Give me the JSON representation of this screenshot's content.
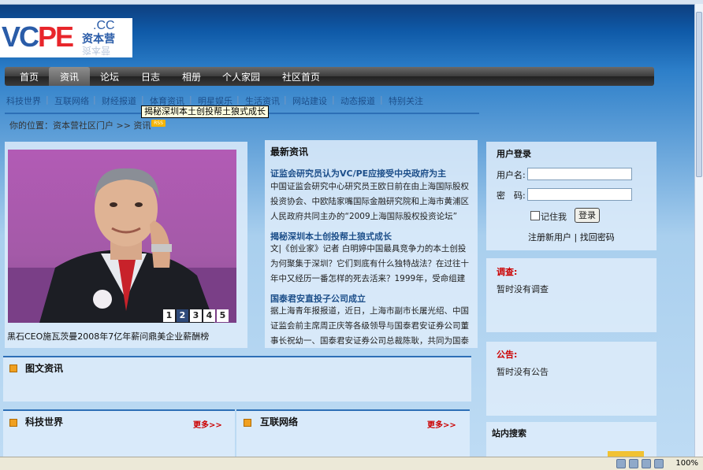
{
  "logo": {
    "text_main": "VC",
    "text_pe": "PE",
    "domain": ".CC",
    "cn": "资本营",
    "reflection": "资本营"
  },
  "nav": [
    "首页",
    "资讯",
    "论坛",
    "日志",
    "相册",
    "个人家园",
    "社区首页"
  ],
  "nav_active": 1,
  "subnav": [
    "科技世界",
    "互联网络",
    "财经报道",
    "体育资讯",
    "明星娱乐",
    "生活资讯",
    "网站建设",
    "动态报道",
    "特别关注"
  ],
  "tooltip": "揭秘深圳本土创投帮土狼式成长",
  "breadcrumb": {
    "prefix": "你的位置：资本营社区门户  >> 资讯",
    "rss": "RSS"
  },
  "photo": {
    "caption": "黑石CEO施瓦茨曼2008年7亿年薪问鼎美企业薪酬榜",
    "pages": [
      "1",
      "2",
      "3",
      "4",
      "5"
    ],
    "active_page": 1
  },
  "latest": {
    "title": "最新资讯",
    "items": [
      {
        "title": "证监会研究员认为VC/PE应接受中央政府为主",
        "body": "中国证监会研究中心研究员王欧日前在由上海国际股权投资协会、中欧陆家嘴国际金融研究院和上海市黄浦区人民政府共同主办的“2009上海国际股权投资论坛”"
      },
      {
        "title": "揭秘深圳本土创投帮土狼式成长",
        "body": "文|《创业家》记者 白明婷中国最具竞争力的本土创投为何聚集于深圳？它们到底有什么独特战法？在过往十年中又经历一番怎样的死去活来？1999年，受命组建"
      },
      {
        "title": "国泰君安直投子公司成立",
        "body": "据上海青年报报道，近日，上海市副市长屠光绍、中国证监会前主席周正庆等各级领导与国泰君安证券公司董事长祝幼一、国泰君安证券公司总裁陈耿，共同为国泰"
      }
    ]
  },
  "login": {
    "title": "用户登录",
    "username_label": "用户名:",
    "password_label": "密　码:",
    "remember": "记住我",
    "button": "登录",
    "register": "注册新用户",
    "divider": "|",
    "forgot": "找回密码"
  },
  "survey": {
    "title": "调查:",
    "text": "暂时没有调查"
  },
  "notice": {
    "title": "公告:",
    "text": "暂时没有公告"
  },
  "site_search": {
    "title": "站内搜索"
  },
  "sections": {
    "pictorial": "图文资讯",
    "tech": "科技世界",
    "internet": "互联网络",
    "more": "更多>>"
  },
  "status": {
    "zoom": "100%"
  },
  "colors": {
    "link_blue": "#1d4f8a",
    "accent_red": "#cc0000",
    "header_line": "#2d6fb6"
  }
}
